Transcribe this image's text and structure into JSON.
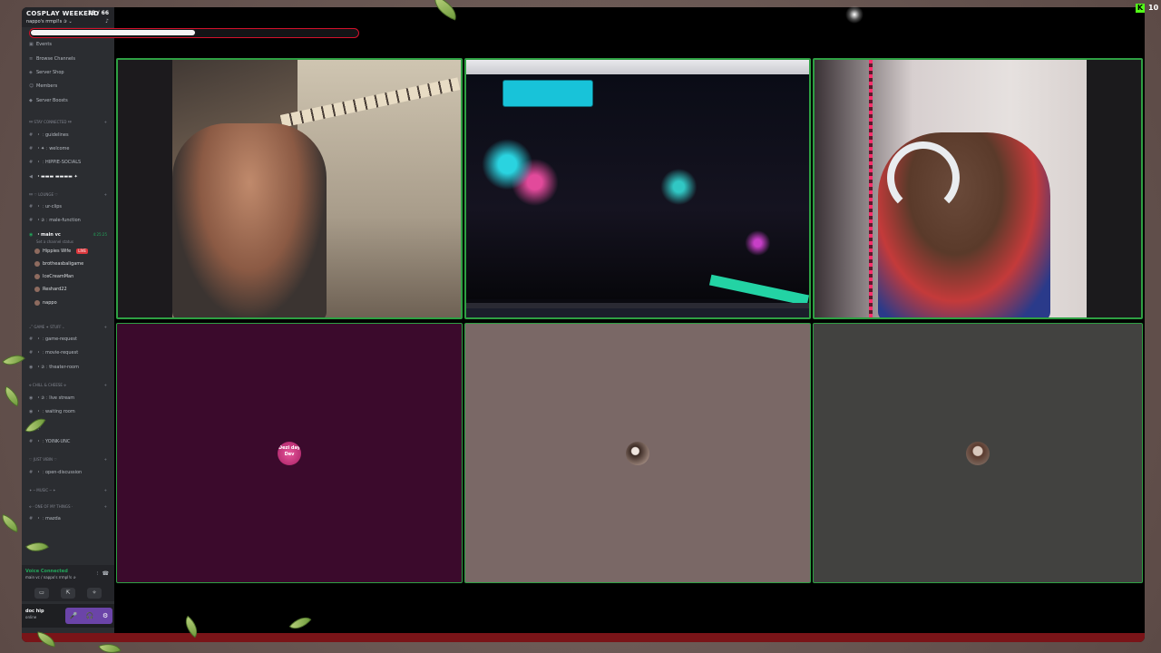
{
  "server": {
    "name": "COSPLAY WEEKEND",
    "boost_count": "33 / 66",
    "boost_progress": 0.5,
    "subtitle": "nappo's rrmpl!s ✰ ⌄"
  },
  "sidebar": {
    "nav": [
      "Events",
      "Browse Channels",
      "Server Shop",
      "Members",
      "Server Boosts"
    ],
    "categories": {
      "c1": "୨୧ stay connected ୨୧",
      "c2": "୨୧ ♡ lounge ♡",
      "c3": "₊˚ game ✦ stuff ₊",
      "c4": "⟡ chill & cheese ⟡",
      "c5": "˚ ✦ ‧₊˚",
      "c6": "♡ just vibin ♡",
      "c7": "✦ ─ music ─ ✦",
      "c8": "⟡ ‧ one of my things ‧"
    },
    "channels": {
      "guidelines": "・﹕guidelines",
      "welcome": "・✦﹕welcome",
      "socials": "・﹕HIPPIE-SOCIALS",
      "bold": "・▬▬▬ ▬▬▬▬ ✦",
      "clips": "・﹕ur-clips",
      "male_function": "・✰﹕male-function",
      "voice_main": "・main vc",
      "voice_status": "Set a channel status",
      "voice_time": "4:25:25",
      "game_request": "・﹕game-request",
      "movie_request": "・﹕movie-request",
      "theater_room": "・✰﹕theater-room",
      "live_stream": "・✰﹕live stream",
      "waiting_room": "・﹕waiting room",
      "yoink": "・﹕YOINK-UNC",
      "open_discussion": "・﹕open-discussion",
      "mazda": "・﹕mazda"
    },
    "voice_users": [
      {
        "name": "Hippies Wife",
        "live": true
      },
      {
        "name": "brotheasbaligame",
        "live": false
      },
      {
        "name": "IceCreamMan",
        "live": false
      },
      {
        "name": "Reshard22",
        "live": false
      },
      {
        "name": "nappo",
        "live": false
      }
    ],
    "live_label": "LIVE"
  },
  "voice_panel": {
    "status": "Voice Connected",
    "channel": "main vc / nappo's rrmpl!s ✰",
    "buttons": {
      "camera": "▭",
      "screen": "⇱",
      "activity": "✧"
    }
  },
  "user_panel": {
    "name": "doc hip",
    "status": "online",
    "controls": {
      "mic": "🎤",
      "headset": "🎧",
      "settings": "⚙"
    }
  },
  "tiles": {
    "avatar_dezi_text": "Dezi day Dev"
  },
  "kick": {
    "logo": "K",
    "count": "10"
  },
  "colors": {
    "accent_green": "#2ea043",
    "boost_red": "#d4112b",
    "tile_purple": "#3b0a2c",
    "tile_mauve": "#7a6866",
    "tile_gray": "#424240"
  }
}
